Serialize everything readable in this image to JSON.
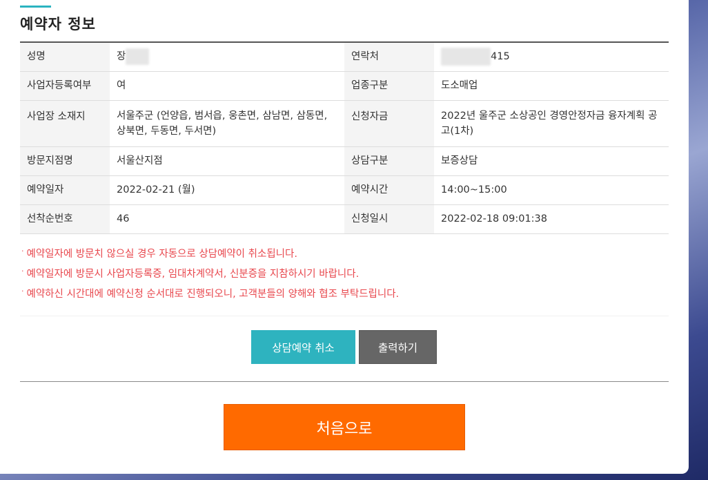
{
  "section_title": "예약자 정보",
  "rows": [
    {
      "l1": "성명",
      "v1": "장",
      "l2": "연락처",
      "v2": "415"
    },
    {
      "l1": "사업자등록여부",
      "v1": "여",
      "l2": "업종구분",
      "v2": "도소매업"
    },
    {
      "l1": "사업장 소재지",
      "v1": "서울주군 (언양읍, 범서읍, 웅촌면, 삼남면, 삼동면, 상북면, 두동면, 두서면)",
      "l2": "신청자금",
      "v2": "2022년 울주군 소상공인 경영안정자금 융자계획 공고(1차)"
    },
    {
      "l1": "방문지점명",
      "v1": "서울산지점",
      "l2": "상담구분",
      "v2": "보증상담"
    },
    {
      "l1": "예약일자",
      "v1": "2022-02-21 (월)",
      "l2": "예약시간",
      "v2": "14:00~15:00"
    },
    {
      "l1": "선착순번호",
      "v1": "46",
      "l2": "신청일시",
      "v2": "2022-02-18 09:01:38"
    }
  ],
  "notes": [
    "예약일자에 방문치 않으실 경우 자동으로 상담예약이 취소됩니다.",
    "예약일자에 방문시 사업자등록증, 임대차계약서, 신분증을 지참하시기 바랍니다.",
    "예약하신 시간대에 예약신청 순서대로 진행되오니, 고객분들의 양해와 협조 부탁드립니다."
  ],
  "buttons": {
    "cancel": "상담예약 취소",
    "print": "출력하기",
    "home": "처음으로"
  },
  "colors": {
    "accent": "#2bb3c0",
    "cancel_button": "#2eb3bf",
    "print_button": "#666666",
    "home_button": "#ff6a00",
    "note_text": "#e8474d"
  }
}
